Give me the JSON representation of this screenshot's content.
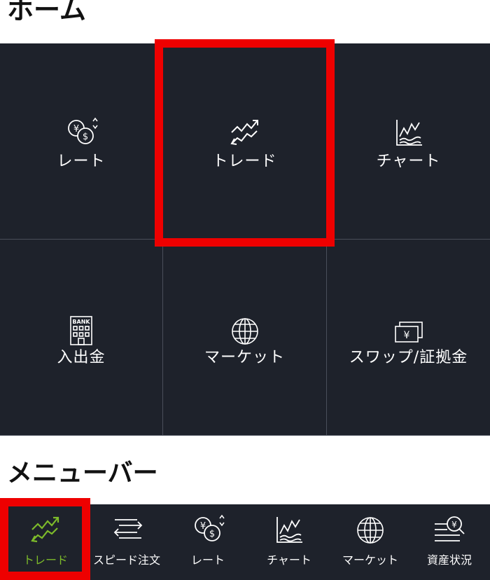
{
  "home": {
    "title": "ホーム",
    "tiles": [
      {
        "label": "レート",
        "icon": "yen-dollar-exchange-icon"
      },
      {
        "label": "トレード",
        "icon": "trade-trend-icon"
      },
      {
        "label": "チャート",
        "icon": "chart-icon"
      },
      {
        "label": "入出金",
        "icon": "bank-icon"
      },
      {
        "label": "マーケット",
        "icon": "globe-icon"
      },
      {
        "label": "スワップ/証拠金",
        "icon": "yen-banknote-icon"
      }
    ]
  },
  "menubar": {
    "title": "メニューバー",
    "items": [
      {
        "label": "トレード",
        "icon": "trade-trend-icon",
        "active": true
      },
      {
        "label": "スピード注文",
        "icon": "speed-order-icon"
      },
      {
        "label": "レート",
        "icon": "yen-dollar-exchange-icon"
      },
      {
        "label": "チャート",
        "icon": "chart-icon"
      },
      {
        "label": "マーケット",
        "icon": "globe-icon"
      },
      {
        "label": "資産状況",
        "icon": "asset-status-icon"
      }
    ]
  },
  "colors": {
    "tile_background": "#1e222b",
    "highlight": "#ee0000",
    "active_accent": "#7dbb2a"
  }
}
